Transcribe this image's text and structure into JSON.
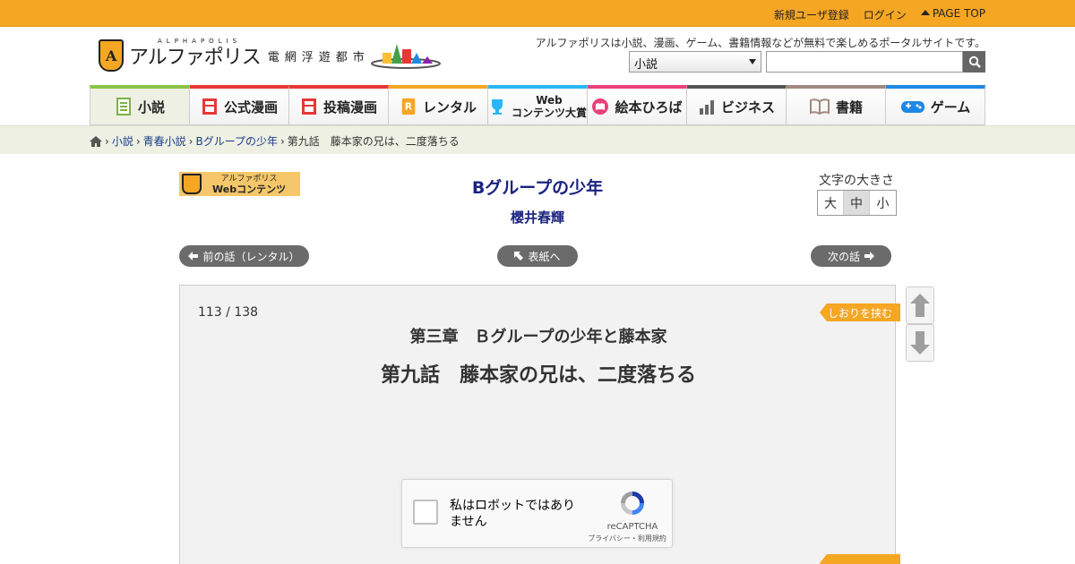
{
  "topbar": {
    "register": "新規ユーザ登録",
    "login": "ログイン",
    "page_top": "PAGE TOP"
  },
  "header": {
    "brand_small": "ALPHAPOLIS",
    "brand": "アルファポリス",
    "city": "電網浮遊都市",
    "tagline": "アルファポリスは小説、漫画、ゲーム、書籍情報などが無料で楽しめるポータルサイトです。",
    "search_category": "小説"
  },
  "nav": [
    {
      "label": "小説",
      "color": "#8bc34a",
      "icon": "book-icon"
    },
    {
      "label": "公式漫画",
      "color": "#e53935",
      "icon": "manga-icon"
    },
    {
      "label": "投稿漫画",
      "color": "#e53935",
      "icon": "manga-icon"
    },
    {
      "label": "レンタル",
      "color": "#f5a623",
      "icon": "rental-icon"
    },
    {
      "label_1": "Web",
      "label_2": "コンテンツ大賞",
      "color": "#29b6f6",
      "icon": "trophy-icon"
    },
    {
      "label": "絵本ひろば",
      "color": "#ec407a",
      "icon": "picture-book-icon"
    },
    {
      "label": "ビジネス",
      "color": "#555555",
      "icon": "chart-icon"
    },
    {
      "label": "書籍",
      "color": "#a1887f",
      "icon": "open-book-icon"
    },
    {
      "label": "ゲーム",
      "color": "#1e88e5",
      "icon": "gamepad-icon"
    }
  ],
  "breadcrumb": {
    "items": [
      "小説",
      "青春小説",
      "Bグループの少年"
    ],
    "current": "第九話　藤本家の兄は、二度落ちる"
  },
  "web_logo": {
    "line1": "アルファポリス",
    "line2": "Webコンテンツ"
  },
  "work": {
    "title": "Bグループの少年",
    "author": "櫻井春輝"
  },
  "font_size": {
    "label": "文字の大きさ",
    "large": "大",
    "medium": "中",
    "small": "小"
  },
  "pager": {
    "prev": "前の話（レンタル）",
    "toc": "表紙へ",
    "next": "次の話"
  },
  "content": {
    "counter": "113 / 138",
    "chapter": "第三章　Ｂグループの少年と藤本家",
    "episode": "第九話　藤本家の兄は、二度落ちる",
    "bookmark": "しおりを挟む"
  },
  "captcha": {
    "text": "私はロボットではありません",
    "brand": "reCAPTCHA",
    "links": "プライバシー・利用規約"
  },
  "colors": {
    "accent": "#f5a623",
    "title": "#1a237e",
    "breadcrumb_bg": "#eef0e3"
  }
}
